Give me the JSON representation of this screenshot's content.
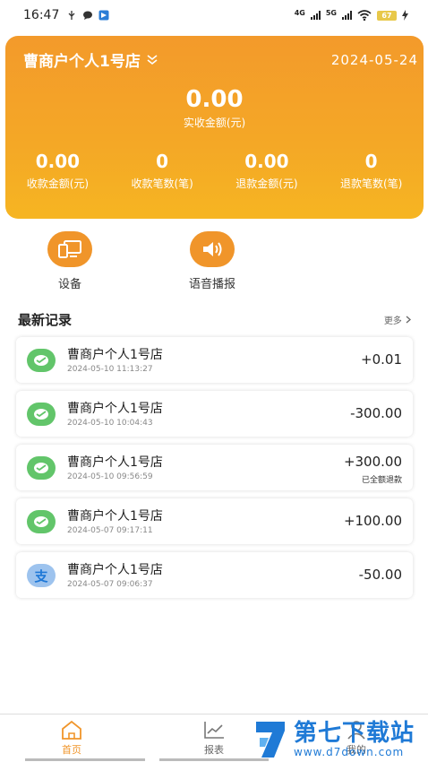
{
  "status_bar": {
    "time": "16:47",
    "network1": "4G",
    "network2": "5G",
    "battery": "67"
  },
  "header": {
    "store_name": "曹商户个人1号店",
    "date": "2024-05-24",
    "main_amount": "0.00",
    "main_label": "实收金额(元)",
    "stats": [
      {
        "value": "0.00",
        "label": "收款金额(元)"
      },
      {
        "value": "0",
        "label": "收款笔数(笔)"
      },
      {
        "value": "0.00",
        "label": "退款金额(元)"
      },
      {
        "value": "0",
        "label": "退款笔数(笔)"
      }
    ]
  },
  "actions": [
    {
      "label": "设备",
      "icon": "device-icon"
    },
    {
      "label": "语音播报",
      "icon": "speaker-icon"
    }
  ],
  "records": {
    "title": "最新记录",
    "more": "更多",
    "items": [
      {
        "name": "曹商户个人1号店",
        "time": "2024-05-10 11:13:27",
        "amount": "+0.01",
        "tag": "",
        "pay": "wechat"
      },
      {
        "name": "曹商户个人1号店",
        "time": "2024-05-10 10:04:43",
        "amount": "-300.00",
        "tag": "",
        "pay": "wechat"
      },
      {
        "name": "曹商户个人1号店",
        "time": "2024-05-10 09:56:59",
        "amount": "+300.00",
        "tag": "已全额退款",
        "pay": "wechat"
      },
      {
        "name": "曹商户个人1号店",
        "time": "2024-05-07 09:17:11",
        "amount": "+100.00",
        "tag": "",
        "pay": "wechat"
      },
      {
        "name": "曹商户个人1号店",
        "time": "2024-05-07 09:06:37",
        "amount": "-50.00",
        "tag": "",
        "pay": "alipay",
        "pay_glyph": "支"
      }
    ]
  },
  "nav": [
    {
      "label": "首页",
      "active": true
    },
    {
      "label": "报表",
      "active": false
    },
    {
      "label": "我的",
      "active": false
    }
  ],
  "watermark": {
    "big": "第七下载站",
    "small": "www.d7down.com"
  },
  "colors": {
    "accent": "#f0952a",
    "hero_top": "#f39a2b",
    "hero_bottom": "#f6b522",
    "wechat": "#62c56a",
    "alipay": "#9dc3ee",
    "watermark": "#1f7ad6"
  }
}
